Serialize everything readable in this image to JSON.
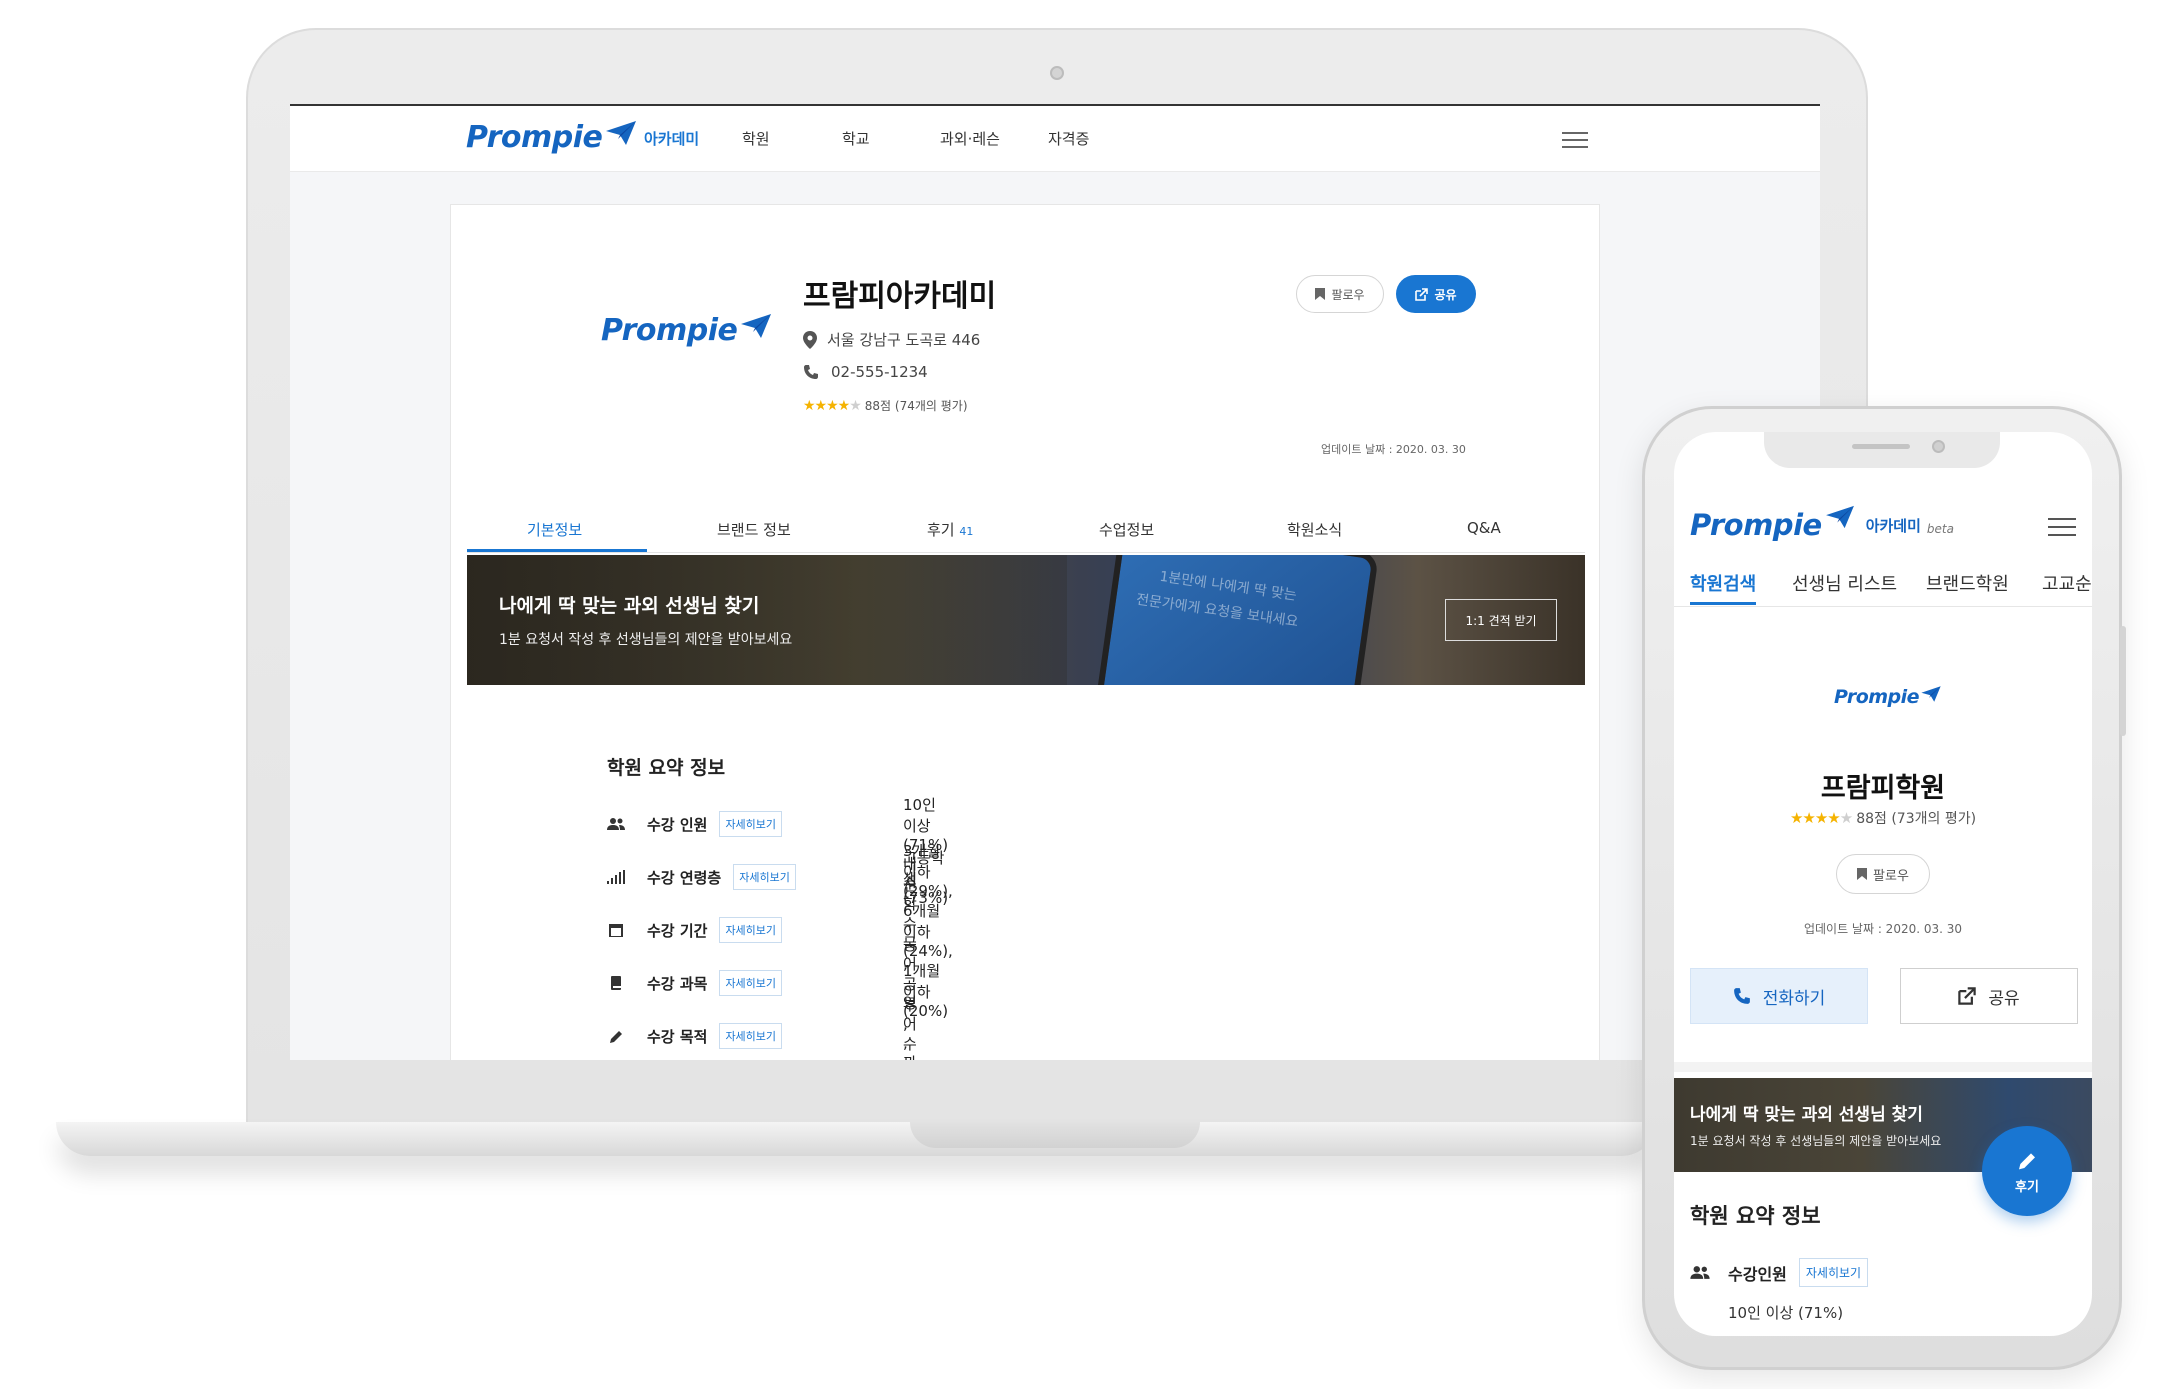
{
  "laptop": {
    "nav": {
      "logo": "Prompie",
      "items": [
        "아카데미",
        "학원",
        "학교",
        "과외·레슨",
        "자격증"
      ]
    },
    "profile": {
      "name": "프람피아카데미",
      "address": "서울 강남구 도곡로 446",
      "phone": "02-555-1234",
      "rating": "88점 (74개의 평가)",
      "rating_stars": 4.5,
      "follow_label": "팔로우",
      "share_label": "공유",
      "updated": "업데이트 날짜 : 2020. 03. 30"
    },
    "tabs": [
      {
        "label": "기본정보",
        "count": ""
      },
      {
        "label": "브랜드 정보",
        "count": ""
      },
      {
        "label": "후기",
        "count": "41"
      },
      {
        "label": "수업정보",
        "count": ""
      },
      {
        "label": "학원소식",
        "count": ""
      },
      {
        "label": "Q&A",
        "count": ""
      }
    ],
    "banner": {
      "title": "나에게 딱 맞는 과외 선생님 찾기",
      "subtitle": "1분 요청서 작성 후 선생님들의 제안을 받아보세요",
      "button": "1:1 견적 받기",
      "phone_text_1": "1분만에 나에게 딱 맞는",
      "phone_text_2": "전문가에게 요청을 보내세요"
    },
    "summary": {
      "title": "학원 요약 정보",
      "detail_label": "자세히보기",
      "rows": [
        {
          "label": "수강 인원",
          "value": "10인 이상 (71%)"
        },
        {
          "label": "수강 연령층",
          "value": "고등학생 (73%)"
        },
        {
          "label": "수강 기간",
          "value": "3개월 이하 (29%), 6개월 이하 (24%), 1개월 이하 (20%)"
        },
        {
          "label": "수강 과목",
          "value": "수학 , 국어 , 영어 , 과학"
        },
        {
          "label": "수강 목적",
          "value": "내신 , 수능 , 공부 , 수능대비 , 성적 향상"
        }
      ]
    }
  },
  "phone": {
    "logo": "Prompie",
    "section": "아카데미",
    "beta": "beta",
    "tabs": [
      "학원검색",
      "선생님 리스트",
      "브랜드학원",
      "고교순"
    ],
    "profile": {
      "logo": "Prompie",
      "name": "프람피학원",
      "rating": "88점 (73개의 평가)",
      "rating_stars": 4.5,
      "follow_label": "팔로우",
      "updated": "업데이트 날짜 : 2020. 03. 30",
      "call_label": "전화하기",
      "share_label": "공유"
    },
    "banner": {
      "title": "나에게 딱 맞는 과외 선생님 찾기",
      "subtitle": "1분 요청서 작성 후 선생님들의 제안을 받아보세요"
    },
    "fab_label": "후기",
    "summary": {
      "title": "학원 요약 정보",
      "row_label": "수강인원",
      "detail_label": "자세히보기",
      "row_value": "10인 이상 (71%)"
    }
  },
  "colors": {
    "brand": "#1565c0",
    "accent": "#1976d2",
    "star": "#f5b301"
  }
}
